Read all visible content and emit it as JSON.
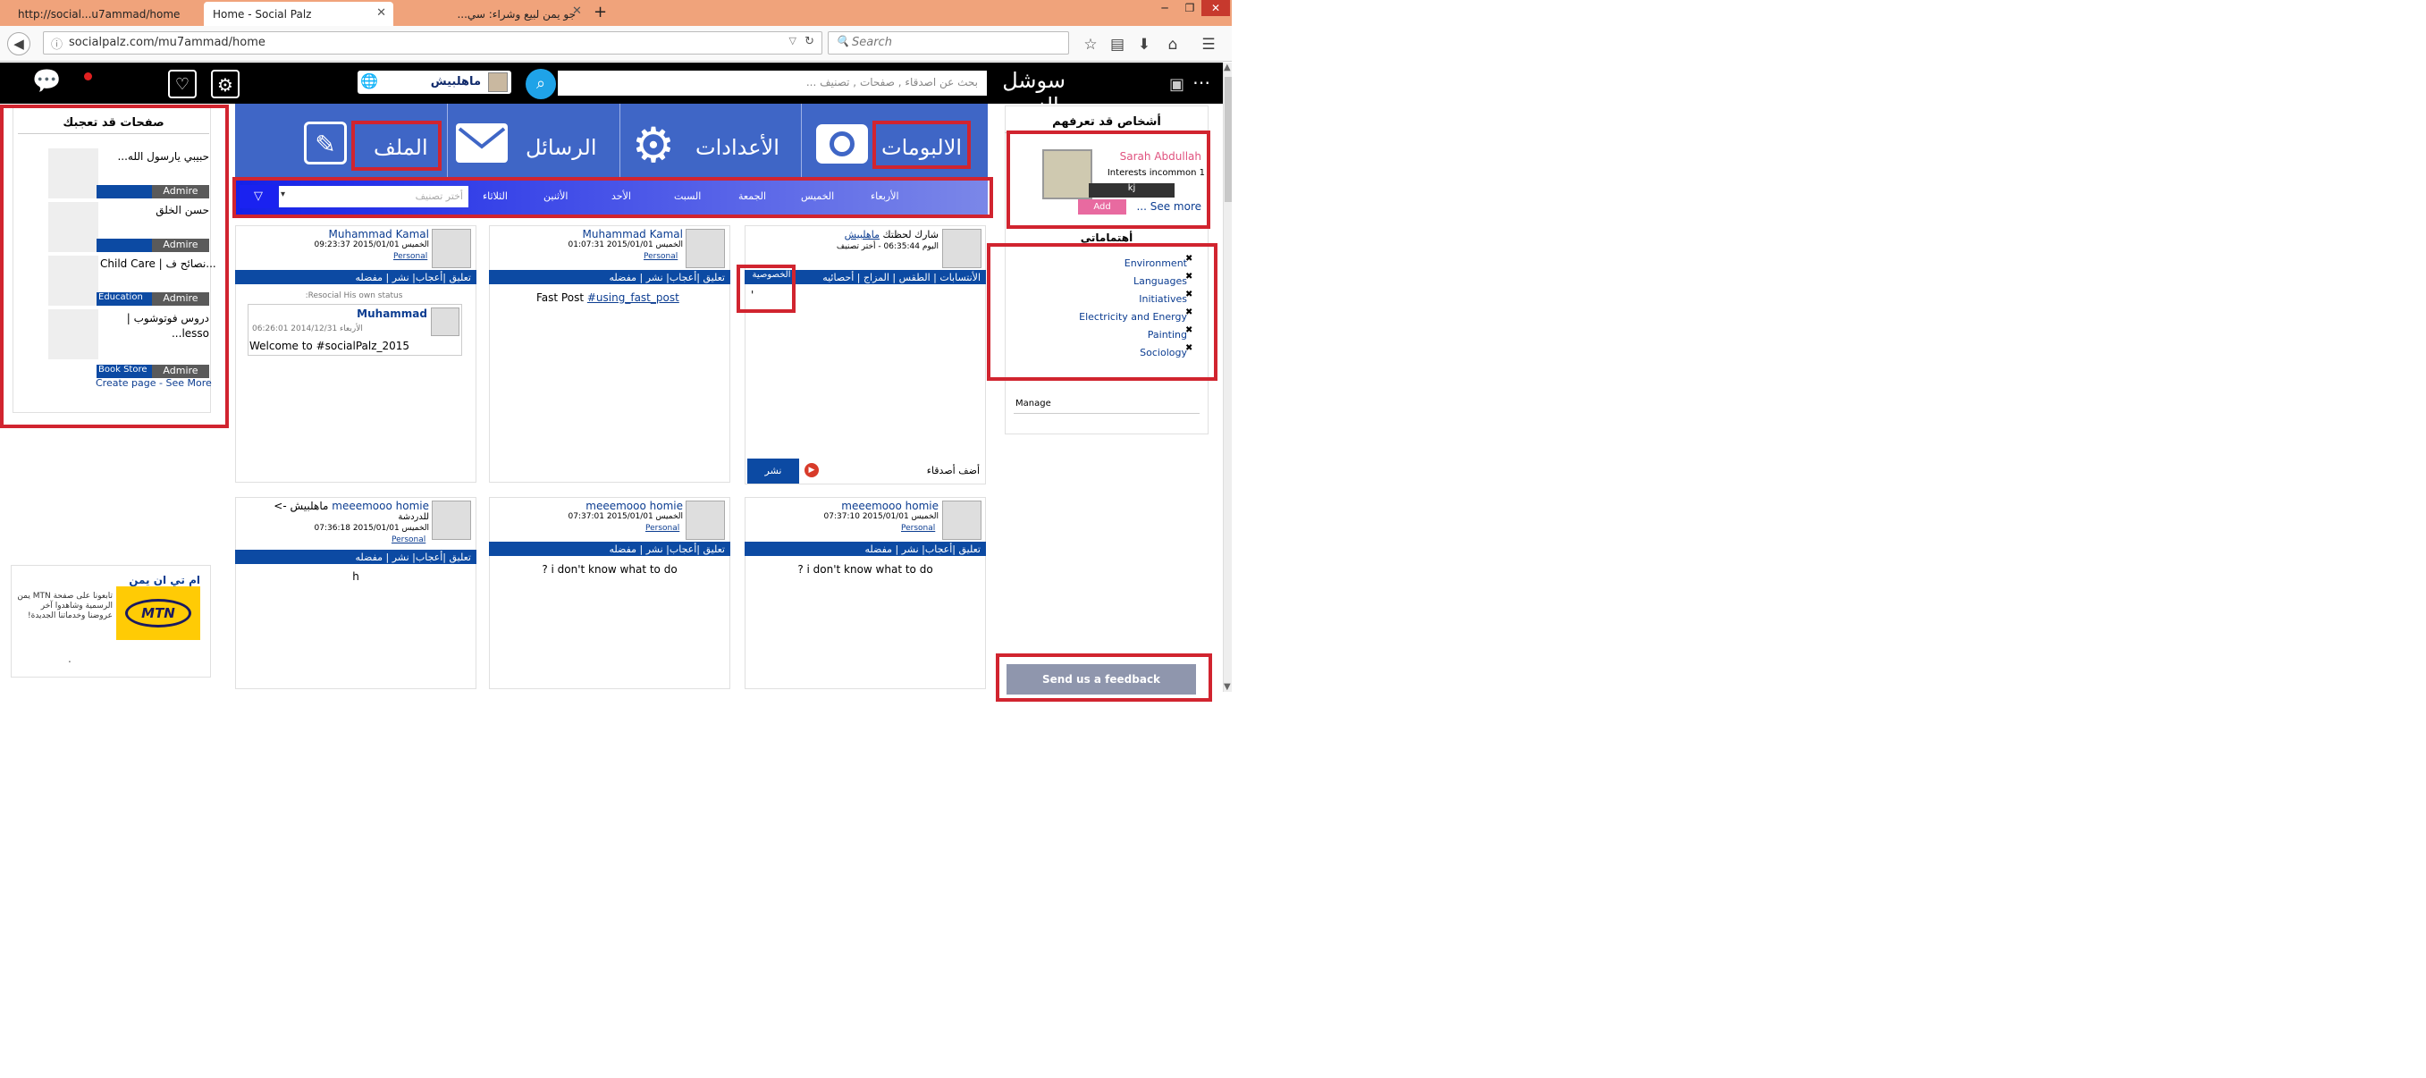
{
  "browser": {
    "tabs": [
      {
        "title": "http://social...u7ammad/home"
      },
      {
        "title": "Home - Social Palz"
      },
      {
        "title": "جو يمن لبيع وشراء: سي..."
      }
    ],
    "url": "socialpalz.com/mu7ammad/home",
    "search_placeholder": "Search"
  },
  "site": {
    "logo": "سوشل بالز",
    "search_placeholder": "بحث عن اصدقاء , صفحات , تصنيف ...",
    "username": "ماهلبيش",
    "nav": {
      "albums": "الالبومات",
      "settings": "الأعدادات",
      "messages": "الرسائل",
      "profile": "الملف"
    },
    "days": [
      "الخميس",
      "الجمعة",
      "السبت",
      "الأحد",
      "الأثنين",
      "الثلاثاء",
      "الأربعاء"
    ],
    "category_placeholder": "أختر تصنيف"
  },
  "left_pages": {
    "title": "صفحات قد تعجبك",
    "items": [
      {
        "name": "حبيبي يارسول الله...",
        "cat": "",
        "btn": "Admire"
      },
      {
        "name": "حسن الخلق",
        "cat": "",
        "btn": "Admire"
      },
      {
        "name": "Child Care | نصائح ف...",
        "cat": "Education",
        "btn": "Admire"
      },
      {
        "name": "دروس فوتوشوب | lesso...",
        "cat": "Book Store",
        "btn": "Admire"
      }
    ],
    "footer": "Create page - See More"
  },
  "ad": {
    "title": "ام تي ان يمن",
    "text": "تابعونا على صفحة MTN يمن الرسمية وشاهدوا آخر عروضنا وخدماتنا الجديدة!",
    "logo": "MTN",
    "dot": "."
  },
  "composer": {
    "prompt": "شارك لحظتك",
    "user": "ماهلبيش",
    "date": "اليوم 06:35:44 - أختر تصنيف",
    "tabs": "الأنتسابات | الطقس | المزاج | أحصائيه",
    "privacy": "الخصوصية",
    "cursor": "'",
    "add_friends": "أضف أصدقاء",
    "post": "نشر"
  },
  "posts": [
    {
      "author": "Muhammad Kamal",
      "date": "الخميس 2015/01/01 01:07:31",
      "tag": "Personal",
      "actions": "تعليق |أعجاب| نشر | مفضله",
      "body": "Fast Post",
      "hashtag": "#using_fast_post"
    },
    {
      "author": "Muhammad Kamal",
      "date": "الخميس 2015/01/01 09:23:37",
      "tag": "Personal",
      "actions": "تعليق |أعجاب| نشر | مفضله",
      "shared": "Resocial His own status:",
      "inner_author": "Muhammad",
      "inner_date": "الأربعاء 2014/12/31 06:26:01",
      "inner_body": "Welcome to #socialPalz_2015"
    },
    {
      "author": "meeemooo homie",
      "date": "الخميس 2015/01/01 07:37:10",
      "tag": "Personal",
      "actions": "تعليق |أعجاب| نشر | مفضله",
      "body": "? i don't know what to do"
    },
    {
      "author": "meeemooo homie",
      "date": "الخميس 2015/01/01 07:37:01",
      "tag": "Personal",
      "actions": "تعليق |أعجاب| نشر | مفضله",
      "body": "? i don't know what to do"
    },
    {
      "author": "meeemooo homie",
      "arrow": "<- ماهلبيش",
      "sub": "للدردشة",
      "date": "الخميس 2015/01/01 07:36:18",
      "tag": "Personal",
      "actions": "تعليق |أعجاب| نشر | مفضله",
      "body": "h"
    }
  ],
  "people": {
    "title": "أشخاص قد تعرفهم",
    "name": "Sarah Abdullah",
    "interests": "Interests incommon 1",
    "bar_text": "kj",
    "add": "Add",
    "see_more": "See more ..."
  },
  "interests": {
    "title": "أهتماماتي",
    "items": [
      "Environment",
      "Languages",
      "Initiatives",
      "Electricity and Energy",
      "Painting",
      "Sociology"
    ],
    "manage": "Manage"
  },
  "feedback": "Send us a feedback"
}
